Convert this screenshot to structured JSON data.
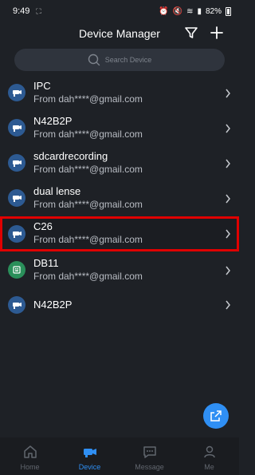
{
  "status": {
    "time": "9:49",
    "battery": "82%",
    "left_icons": "⛶"
  },
  "header": {
    "title": "Device Manager"
  },
  "search": {
    "placeholder": "Search Device"
  },
  "devices": [
    {
      "name": "IPC",
      "sub": "From dah****@gmail.com",
      "icon": "camera-icon",
      "selected": false
    },
    {
      "name": "N42B2P",
      "sub": "",
      "icon": "camera-icon",
      "selected": false
    },
    {
      "name": "sdcardrecording",
      "sub": "From dah****@gmail.com",
      "icon": "camera-icon",
      "selected": false
    },
    {
      "name": "dual lense",
      "sub": "From dah****@gmail.com",
      "icon": "camera-icon",
      "selected": false
    },
    {
      "name": "C26",
      "sub": "From dah****@gmail.com",
      "icon": "camera-icon",
      "selected": true
    },
    {
      "name": "DB11",
      "sub": "From dah****@gmail.com",
      "icon": "doorbell-icon",
      "selected": false
    },
    {
      "name": "N42B2P",
      "sub": "",
      "icon": "camera-icon",
      "selected": false
    }
  ],
  "tabs": [
    {
      "label": "Home",
      "icon": "home-icon",
      "active": false
    },
    {
      "label": "Device",
      "icon": "device-icon",
      "active": true
    },
    {
      "label": "Message",
      "icon": "message-icon",
      "active": false
    },
    {
      "label": "Me",
      "icon": "person-icon",
      "active": false
    }
  ],
  "colors": {
    "accent": "#2f8ff4",
    "background": "#1e2126",
    "selection": "#e00000"
  }
}
